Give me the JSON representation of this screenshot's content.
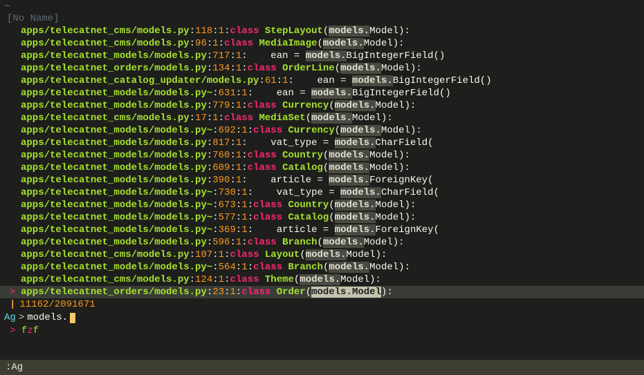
{
  "header": {
    "tilde": "~",
    "title": "[No Name]"
  },
  "results": [
    {
      "sel": false,
      "path": "apps/telecatnet_cms/models.py",
      "line": "118",
      "col": "1",
      "kw": "class",
      "indent": "",
      "name": "StepLayout",
      "type": "cls",
      "paren": "(",
      "mod": "models",
      "member": "Model",
      "close": "):"
    },
    {
      "sel": false,
      "path": "apps/telecatnet_cms/models.py",
      "line": "96",
      "col": "1",
      "kw": "class",
      "indent": "",
      "name": "MediaImage",
      "type": "cls",
      "paren": "(",
      "mod": "models",
      "member": "Model",
      "close": "):"
    },
    {
      "sel": false,
      "path": "apps/telecatnet_models/models.py",
      "line": "717",
      "col": "1",
      "kw": "",
      "indent": "    ",
      "name": "ean",
      "type": "var",
      "eq": " = ",
      "mod": "models",
      "member": "BigIntegerField",
      "close": "()"
    },
    {
      "sel": false,
      "path": "apps/telecatnet_orders/models.py",
      "line": "134",
      "col": "1",
      "kw": "class",
      "indent": "",
      "name": "OrderLine",
      "type": "cls",
      "paren": "(",
      "mod": "models",
      "member": "Model",
      "close": "):"
    },
    {
      "sel": false,
      "path": "apps/telecatnet_catalog_updater/models.py",
      "line": "61",
      "col": "1",
      "kw": "",
      "indent": "    ",
      "name": "ean",
      "type": "var",
      "eq": " = ",
      "mod": "models",
      "member": "BigIntegerField",
      "close": "()"
    },
    {
      "sel": false,
      "path": "apps/telecatnet_models/models.py~",
      "line": "631",
      "col": "1",
      "kw": "",
      "indent": "    ",
      "name": "ean",
      "type": "var",
      "eq": " = ",
      "mod": "models",
      "member": "BigIntegerField",
      "close": "()"
    },
    {
      "sel": false,
      "path": "apps/telecatnet_models/models.py",
      "line": "779",
      "col": "1",
      "kw": "class",
      "indent": "",
      "name": "Currency",
      "type": "cls",
      "paren": "(",
      "mod": "models",
      "member": "Model",
      "close": "):"
    },
    {
      "sel": false,
      "path": "apps/telecatnet_cms/models.py",
      "line": "17",
      "col": "1",
      "kw": "class",
      "indent": "",
      "name": "MediaSet",
      "type": "cls",
      "paren": "(",
      "mod": "models",
      "member": "Model",
      "close": "):"
    },
    {
      "sel": false,
      "path": "apps/telecatnet_models/models.py~",
      "line": "692",
      "col": "1",
      "kw": "class",
      "indent": "",
      "name": "Currency",
      "type": "cls",
      "paren": "(",
      "mod": "models",
      "member": "Model",
      "close": "):"
    },
    {
      "sel": false,
      "path": "apps/telecatnet_models/models.py",
      "line": "817",
      "col": "1",
      "kw": "",
      "indent": "    ",
      "name": "vat_type",
      "type": "var",
      "eq": " = ",
      "mod": "models",
      "member": "CharField",
      "close": "("
    },
    {
      "sel": false,
      "path": "apps/telecatnet_models/models.py",
      "line": "760",
      "col": "1",
      "kw": "class",
      "indent": "",
      "name": "Country",
      "type": "cls",
      "paren": "(",
      "mod": "models",
      "member": "Model",
      "close": "):"
    },
    {
      "sel": false,
      "path": "apps/telecatnet_models/models.py",
      "line": "609",
      "col": "1",
      "kw": "class",
      "indent": "",
      "name": "Catalog",
      "type": "cls",
      "paren": "(",
      "mod": "models",
      "member": "Model",
      "close": "):"
    },
    {
      "sel": false,
      "path": "apps/telecatnet_models/models.py",
      "line": "390",
      "col": "1",
      "kw": "",
      "indent": "    ",
      "name": "article",
      "type": "var",
      "eq": " = ",
      "mod": "models",
      "member": "ForeignKey",
      "close": "("
    },
    {
      "sel": false,
      "path": "apps/telecatnet_models/models.py~",
      "line": "730",
      "col": "1",
      "kw": "",
      "indent": "    ",
      "name": "vat_type",
      "type": "var",
      "eq": " = ",
      "mod": "models",
      "member": "CharField",
      "close": "("
    },
    {
      "sel": false,
      "path": "apps/telecatnet_models/models.py~",
      "line": "673",
      "col": "1",
      "kw": "class",
      "indent": "",
      "name": "Country",
      "type": "cls",
      "paren": "(",
      "mod": "models",
      "member": "Model",
      "close": "):"
    },
    {
      "sel": false,
      "path": "apps/telecatnet_models/models.py~",
      "line": "577",
      "col": "1",
      "kw": "class",
      "indent": "",
      "name": "Catalog",
      "type": "cls",
      "paren": "(",
      "mod": "models",
      "member": "Model",
      "close": "):"
    },
    {
      "sel": false,
      "path": "apps/telecatnet_models/models.py~",
      "line": "369",
      "col": "1",
      "kw": "",
      "indent": "    ",
      "name": "article",
      "type": "var",
      "eq": " = ",
      "mod": "models",
      "member": "ForeignKey",
      "close": "("
    },
    {
      "sel": false,
      "path": "apps/telecatnet_models/models.py",
      "line": "596",
      "col": "1",
      "kw": "class",
      "indent": "",
      "name": "Branch",
      "type": "cls",
      "paren": "(",
      "mod": "models",
      "member": "Model",
      "close": "):"
    },
    {
      "sel": false,
      "path": "apps/telecatnet_cms/models.py",
      "line": "107",
      "col": "1",
      "kw": "class",
      "indent": "",
      "name": "Layout",
      "type": "cls",
      "paren": "(",
      "mod": "models",
      "member": "Model",
      "close": "):"
    },
    {
      "sel": false,
      "path": "apps/telecatnet_models/models.py~",
      "line": "564",
      "col": "1",
      "kw": "class",
      "indent": "",
      "name": "Branch",
      "type": "cls",
      "paren": "(",
      "mod": "models",
      "member": "Model",
      "close": "):"
    },
    {
      "sel": false,
      "path": "apps/telecatnet_cms/models.py",
      "line": "124",
      "col": "1",
      "kw": "class",
      "indent": "",
      "name": "Theme",
      "type": "cls",
      "paren": "(",
      "mod": "models",
      "member": "Model",
      "close": "):"
    },
    {
      "sel": true,
      "path": "apps/telecatnet_orders/models.py",
      "line": "23",
      "col": "1",
      "kw": "class",
      "indent": "",
      "name": "Order",
      "type": "cls",
      "paren": "(",
      "mod": "models",
      "member": "Model",
      "close": "):"
    }
  ],
  "stats": {
    "bar": "|",
    "matches": "11162",
    "sep": "/",
    "total": "2091671"
  },
  "prompt": {
    "label": "Ag",
    "gt": ">",
    "query": "models."
  },
  "fzf": {
    "gt": ">",
    "f": "f",
    "z": "z",
    "f2": "f"
  },
  "status": {
    "text": ":Ag"
  }
}
